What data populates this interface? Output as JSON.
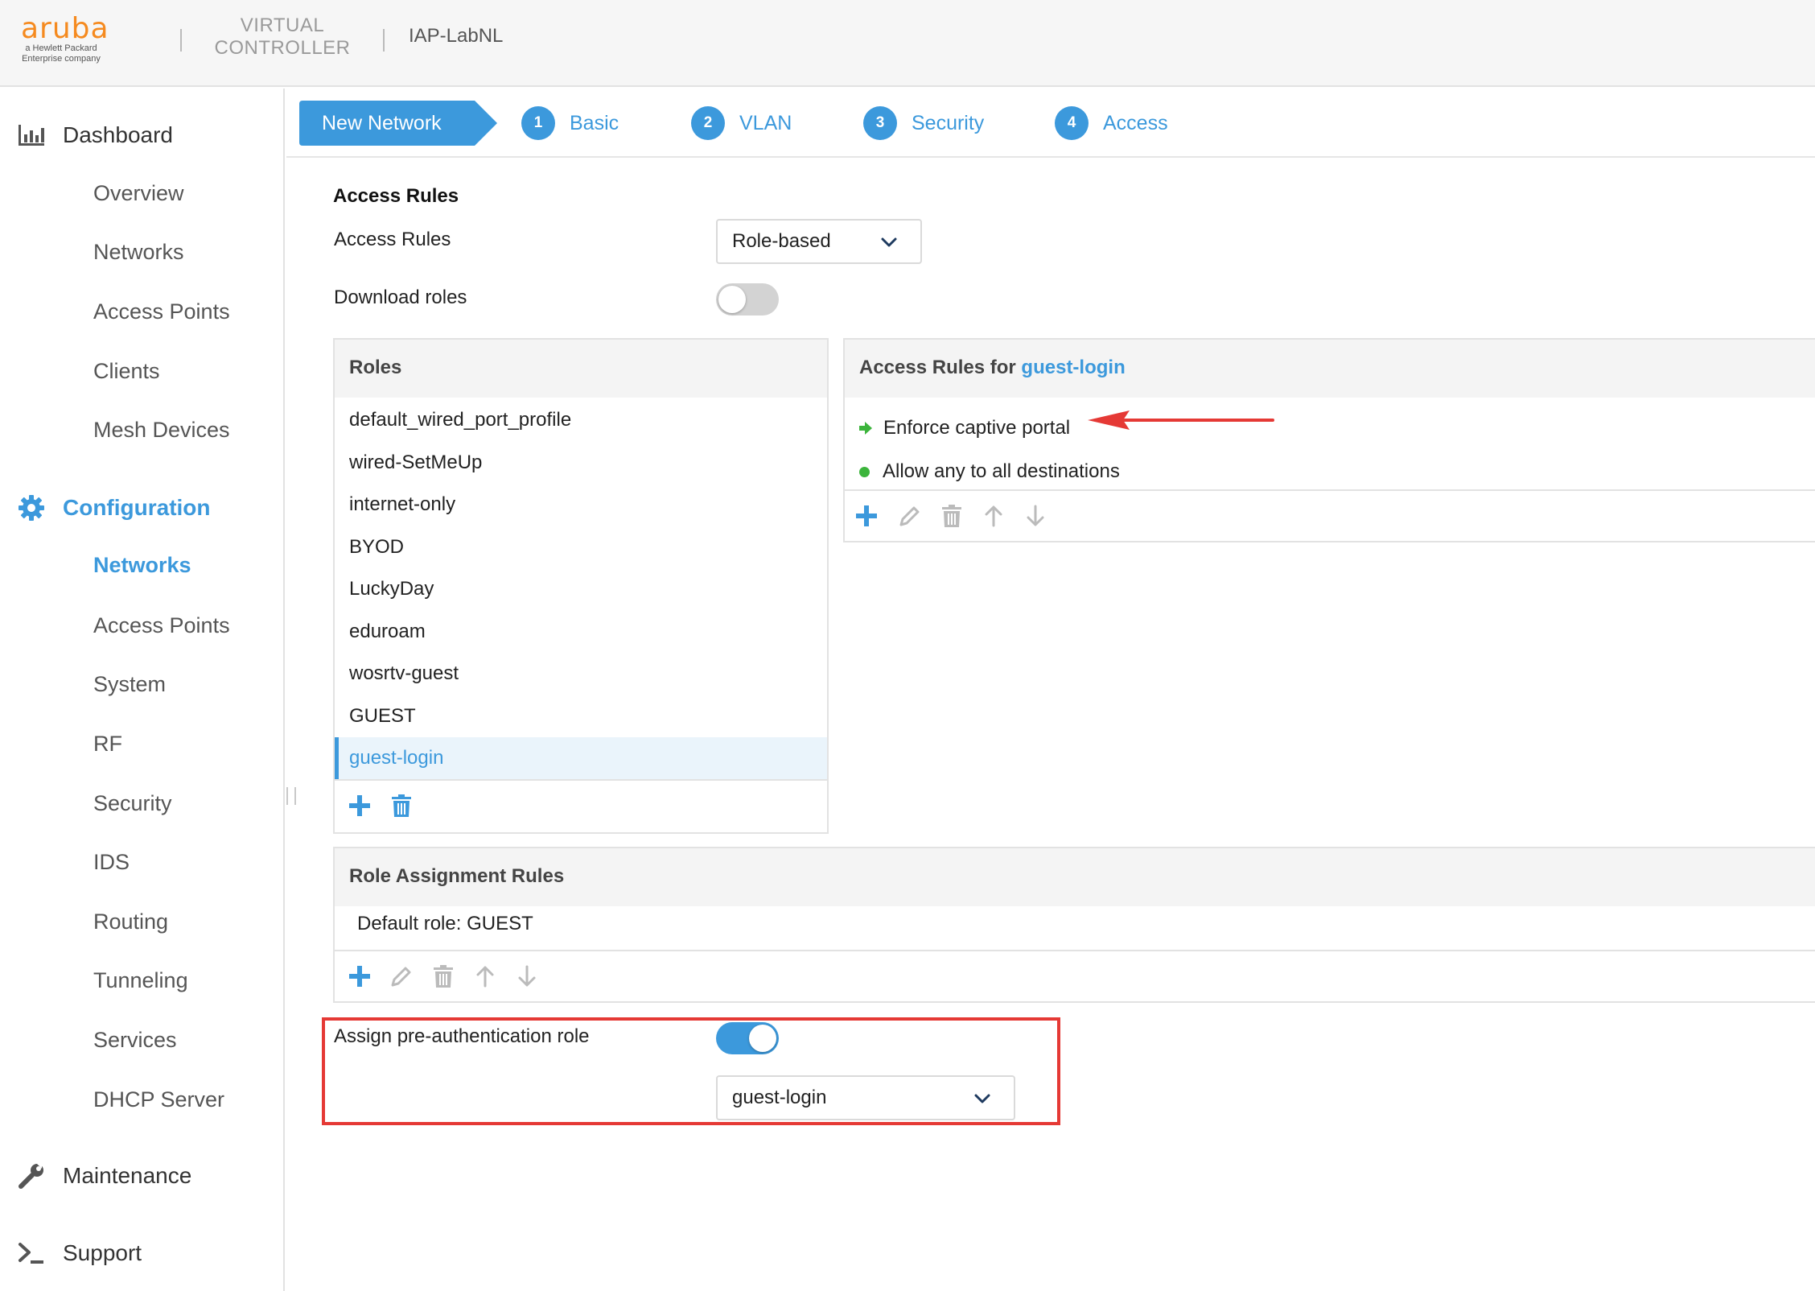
{
  "header": {
    "logo_word": "aruba",
    "logo_sub_1": "a Hewlett Packard",
    "logo_sub_2": "Enterprise company",
    "vc_line1": "VIRTUAL",
    "vc_line2": "CONTROLLER",
    "cluster_name": "IAP-LabNL"
  },
  "sidebar": {
    "dashboard": "Dashboard",
    "dashboard_items": [
      "Overview",
      "Networks",
      "Access Points",
      "Clients",
      "Mesh Devices"
    ],
    "configuration": "Configuration",
    "configuration_items": [
      "Networks",
      "Access Points",
      "System",
      "RF",
      "Security",
      "IDS",
      "Routing",
      "Tunneling",
      "Services",
      "DHCP Server"
    ],
    "active_item": "Networks",
    "maintenance": "Maintenance",
    "support": "Support"
  },
  "wizard": {
    "current": "New Network",
    "steps": [
      {
        "num": "1",
        "label": "Basic"
      },
      {
        "num": "2",
        "label": "VLAN"
      },
      {
        "num": "3",
        "label": "Security"
      },
      {
        "num": "4",
        "label": "Access"
      }
    ]
  },
  "form": {
    "section_title": "Access Rules",
    "access_rules_label": "Access Rules",
    "access_rules_value": "Role-based",
    "download_roles_label": "Download roles",
    "download_roles_on": false,
    "roles_header": "Roles",
    "roles": [
      "default_wired_port_profile",
      "wired-SetMeUp",
      "internet-only",
      "BYOD",
      "LuckyDay",
      "eduroam",
      "wosrtv-guest",
      "GUEST",
      "guest-login"
    ],
    "selected_role": "guest-login",
    "access_rules_for_prefix": "Access Rules for ",
    "access_rules_for_role": "guest-login",
    "rules": [
      "Enforce captive portal",
      "Allow any to all destinations"
    ],
    "role_assignment_header": "Role Assignment Rules",
    "default_role": "Default role: GUEST",
    "pre_auth_label": "Assign pre-authentication role",
    "pre_auth_on": true,
    "pre_auth_value": "guest-login"
  },
  "colors": {
    "accent": "#3c99dc",
    "brand_orange": "#f58a1f",
    "annotation_red": "#e53935",
    "rule_green": "#3cb43c"
  },
  "icons": [
    "bar-chart-icon",
    "gear-icon",
    "wrench-icon",
    "terminal-icon",
    "chevron-down-icon",
    "plus-icon",
    "trash-icon",
    "pencil-icon",
    "arrow-up-icon",
    "arrow-down-icon",
    "green-arrow-icon",
    "green-dot-icon"
  ]
}
